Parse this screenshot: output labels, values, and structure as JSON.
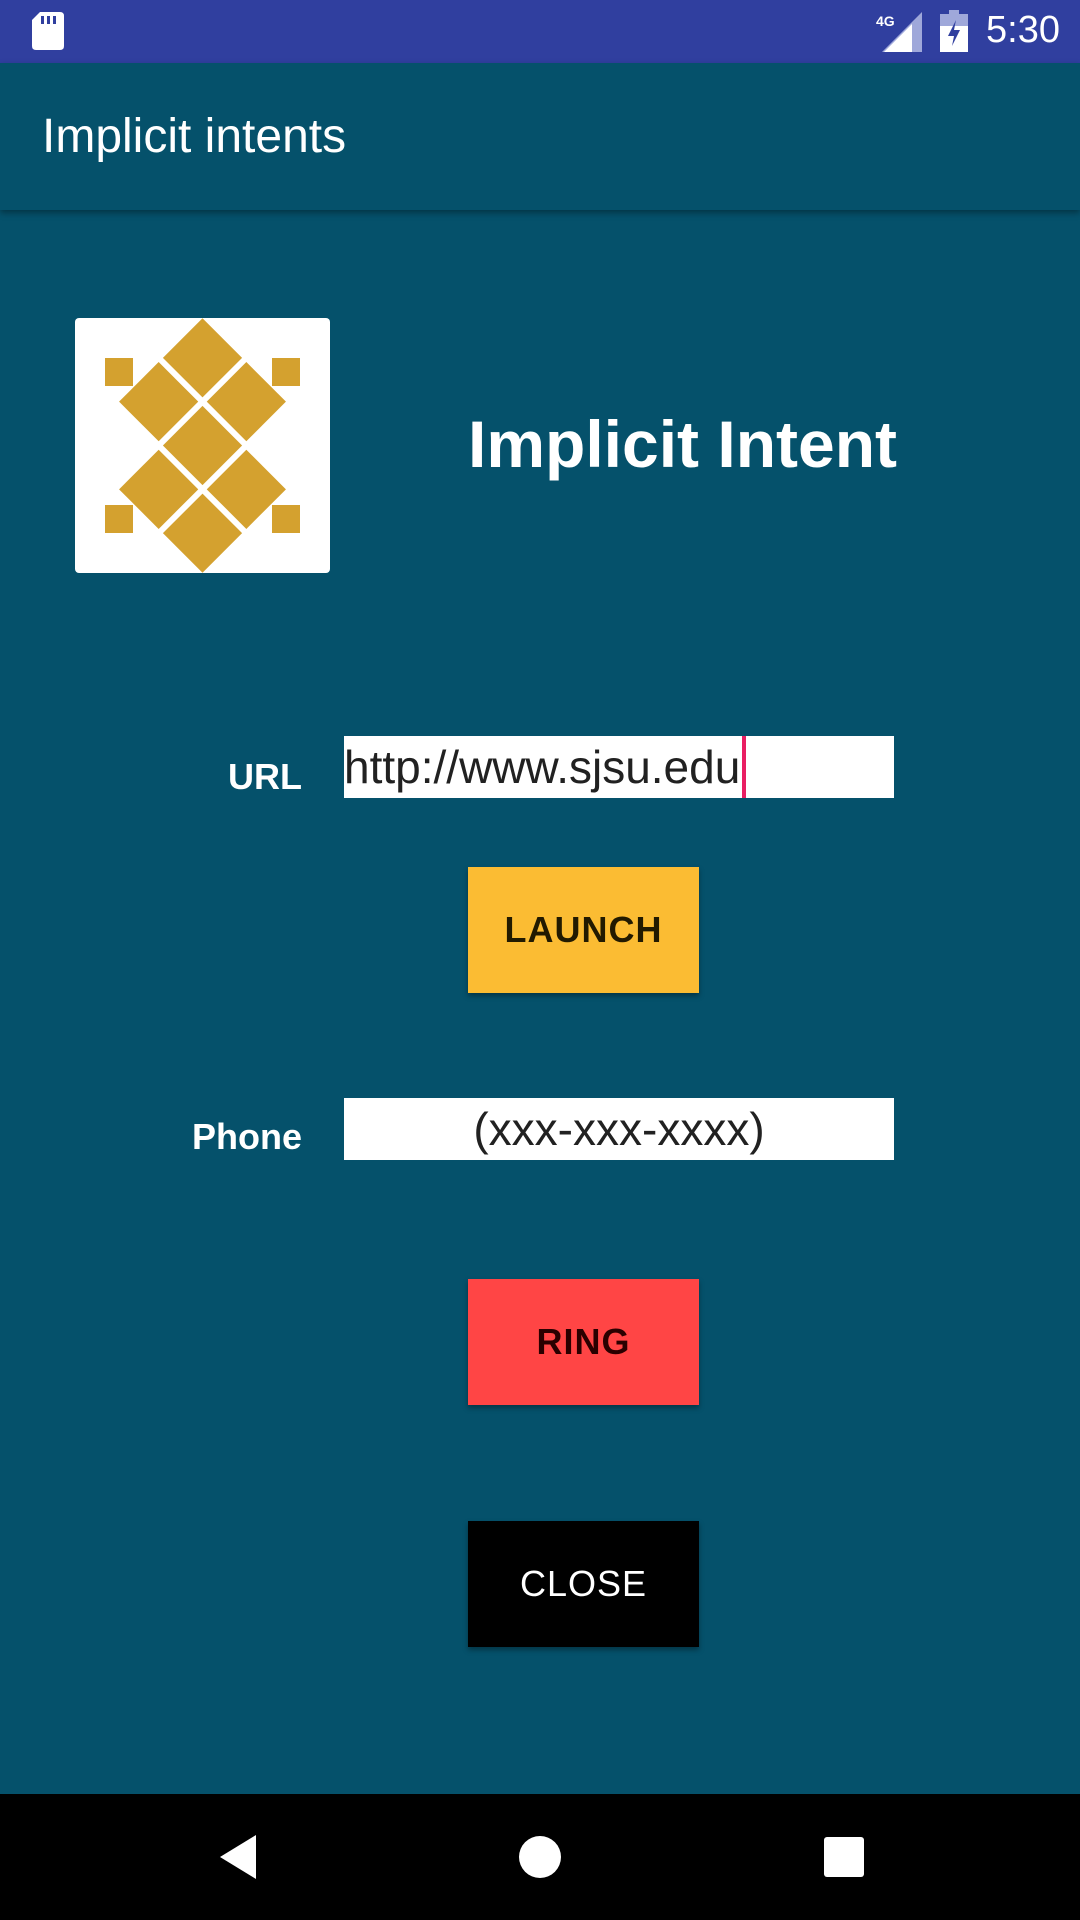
{
  "status_bar": {
    "time": "5:30",
    "network": "4G",
    "icons": [
      "sd-card-icon",
      "signal-icon",
      "battery-charging-icon"
    ]
  },
  "app_bar": {
    "title": "Implicit intents"
  },
  "content": {
    "logo_icon": "diamond-logo-icon",
    "heading": "Implicit Intent",
    "url_label": "URL",
    "url_value": "http://www.sjsu.edu",
    "phone_label": "Phone",
    "phone_placeholder": "(xxx-xxx-xxxx)",
    "launch_label": "LAUNCH",
    "ring_label": "RING",
    "close_label": "CLOSE"
  },
  "colors": {
    "background": "#05516b",
    "status_bar": "#303f9f",
    "launch": "#fbbc33",
    "ring": "#ff4545",
    "close": "#000000",
    "logo_gold": "#d4a12f",
    "caret": "#e91e63"
  },
  "nav_bar": {
    "icons": [
      "back-icon",
      "home-icon",
      "recents-icon"
    ]
  }
}
